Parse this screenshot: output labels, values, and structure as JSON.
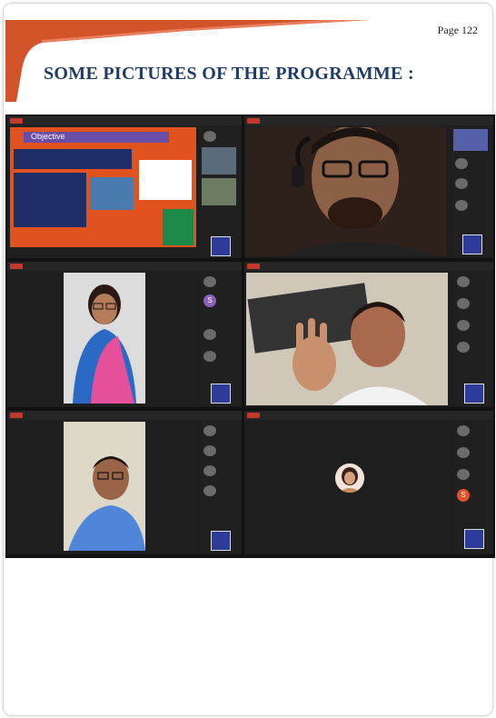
{
  "page": {
    "number_text": "Page 122",
    "title": "SOME PICTURES OF THE PROGRAMME :"
  },
  "screens": [
    {
      "slide_title": "Objective",
      "logo": "college-logo"
    },
    {
      "logo": "college-logo"
    },
    {
      "participant_initial": "S",
      "logo": "college-logo"
    },
    {
      "logo": "college-logo"
    },
    {
      "logo": "college-logo"
    },
    {
      "participant_initial": "S",
      "logo": "college-logo"
    }
  ],
  "colors": {
    "banner": "#d3542b",
    "title": "#1f3d66",
    "record": "#c0392b"
  }
}
